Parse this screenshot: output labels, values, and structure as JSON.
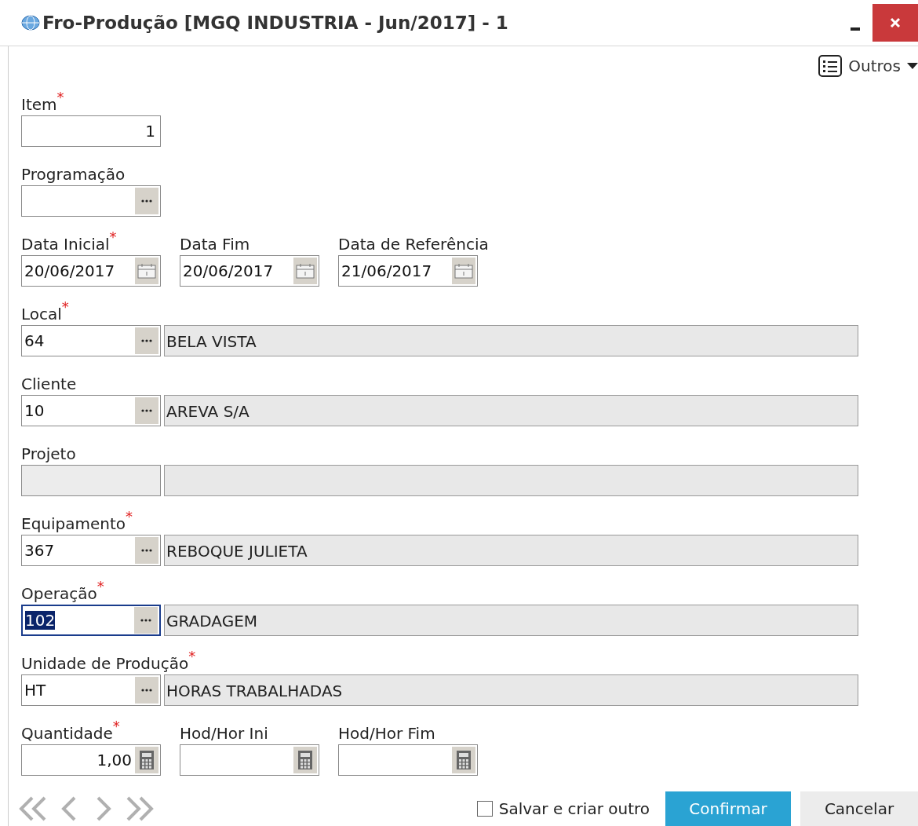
{
  "window": {
    "title": "Fro-Produção [MGQ INDUSTRIA - Jun/2017]  - 1"
  },
  "toolbar": {
    "menu": "Outros"
  },
  "rows": [
    [
      {
        "label": "Item",
        "required_mark": "*",
        "kind": "number",
        "value": "1",
        "focused": false
      }
    ],
    [
      {
        "label": "Programação",
        "kind": "lookup",
        "focused": false
      }
    ],
    [
      {
        "label": "Data Inicial",
        "required_mark": "*",
        "kind": "date",
        "value": "20/06/2017",
        "focused": false
      },
      {
        "label": "Data Fim",
        "kind": "date",
        "value": "20/06/2017",
        "focused": false
      },
      {
        "label": "Data de Referência",
        "kind": "date",
        "value": "21/06/2017",
        "focused": false
      }
    ],
    [
      {
        "label": "Local",
        "required_mark": "*",
        "kind": "lookup",
        "value": "64",
        "description": "BELA VISTA",
        "focused": false
      }
    ],
    [
      {
        "label": "Cliente",
        "kind": "lookup",
        "value": "10",
        "description": "AREVA S/A",
        "focused": false
      }
    ],
    [
      {
        "label": "Projeto",
        "kind": "disabled",
        "focused": false
      }
    ],
    [
      {
        "label": "Equipamento",
        "required_mark": "*",
        "kind": "lookup",
        "value": "367",
        "description": "REBOQUE JULIETA",
        "focused": false
      }
    ],
    [
      {
        "label": "Operação",
        "required_mark": "*",
        "kind": "lookup",
        "value": "102",
        "description": "GRADAGEM",
        "focused": true
      }
    ],
    [
      {
        "label": "Unidade de Produção",
        "required_mark": "*",
        "kind": "lookup",
        "value": "HT",
        "description": "HORAS TRABALHADAS",
        "focused": false
      }
    ],
    [
      {
        "label": "Quantidade",
        "required_mark": "*",
        "kind": "calc",
        "value": "1,00",
        "focused": false
      },
      {
        "label": "Hod/Hor Ini",
        "kind": "calc",
        "focused": false
      },
      {
        "label": "Hod/Hor Fim",
        "kind": "calc",
        "focused": false
      }
    ]
  ],
  "footer": {
    "save_and_new": {
      "label": "Salvar e criar outro",
      "checked": false
    },
    "buttons": [
      {
        "label": "Confirmar",
        "kind": "primary"
      },
      {
        "label": "Cancelar",
        "kind": "secondary"
      }
    ]
  }
}
